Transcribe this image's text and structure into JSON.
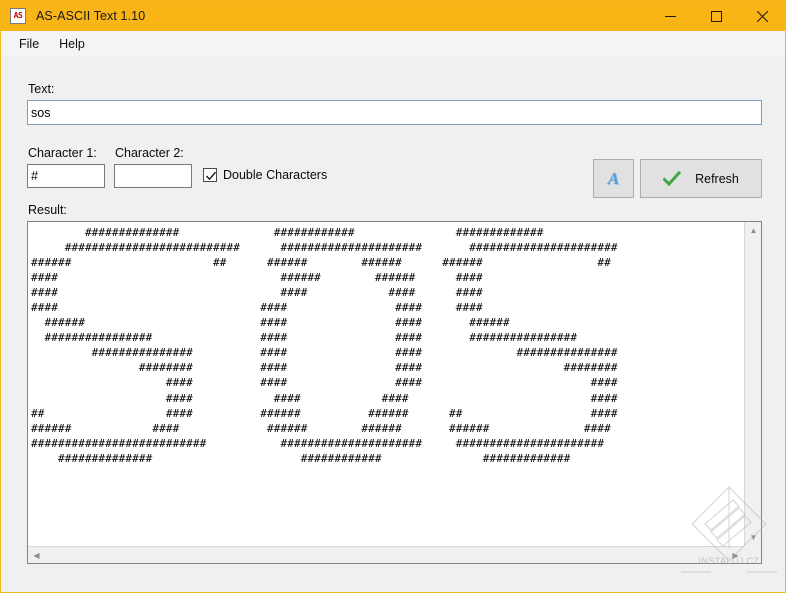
{
  "window": {
    "title": "AS-ASCII Text 1.10",
    "icon_label": "AS",
    "titlebar_color": "#f9b415",
    "minimize_name": "minimize",
    "maximize_name": "maximize",
    "close_name": "close"
  },
  "menubar": {
    "items": [
      {
        "label": "File"
      },
      {
        "label": "Help"
      }
    ]
  },
  "form": {
    "text_label": "Text:",
    "text_value": "sos",
    "text_placeholder": "",
    "char1_label": "Character 1:",
    "char1_value": "#",
    "char1_placeholder": "",
    "char2_label": "Character 2:",
    "char2_value": "",
    "char2_placeholder": "",
    "double_characters_label": "Double Characters",
    "double_characters_checked": "checked",
    "font_button_glyph": "A",
    "refresh_label": "Refresh"
  },
  "result": {
    "label": "Result:",
    "ascii_art": "        ##############              ############               #############\n     ##########################      #####################       ######################\n######                     ##      ######        ######      ######                 ##\n####                                 ######        ######      ####\n####                                 ####            ####      ####\n####                              ####                ####     ####\n  ######                          ####                ####       ######\n  ################                ####                ####       ################\n         ###############          ####                ####              ###############\n                ########          ####                ####                     ########\n                    ####          ####                ####                         ####\n                    ####            ####            ####                           ####\n##                  ####          ######          ######      ##                   ####\n######            ####             ######        ######       ######              ####\n##########################           #####################     ######################\n    ##############                      ############               #############",
    "scrollbar_vertical_name": "result-vertical-scrollbar",
    "scrollbar_horizontal_name": "result-horizontal-scrollbar"
  },
  "watermark": {
    "text": "INSTALUJ.CZ"
  }
}
